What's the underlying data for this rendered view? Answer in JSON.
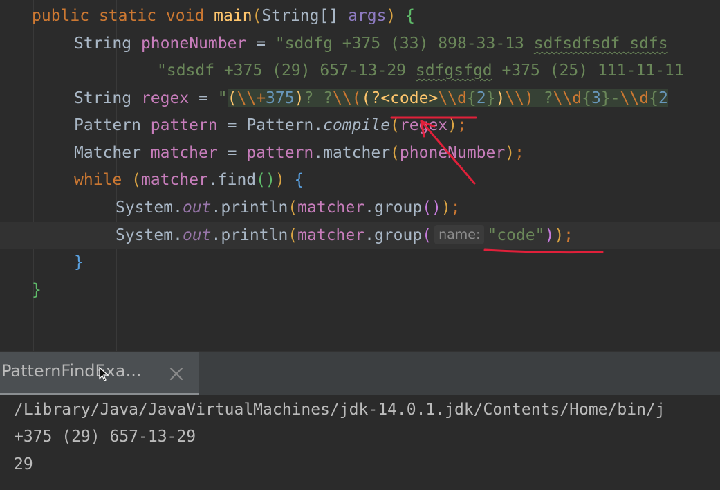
{
  "editor": {
    "lines": [
      {
        "parts": [
          "public",
          "static",
          "void",
          "main",
          "(",
          "String",
          "[]",
          "args",
          ")",
          "{"
        ]
      },
      {
        "var_type": "String",
        "var_name": "phoneNumber",
        "op": "=",
        "str_a": "\"sddfg +375 (33) 898-33-13 ",
        "str_b": "sdfsdfsdf",
        "str_c": " sdfs"
      },
      {
        "str_a": "\"sdsdf +375 (29) 657-13-29 ",
        "str_b": "sdfgsfgd",
        "str_c": " +375 (25) 111-11-11"
      },
      {
        "var_type": "String",
        "var_name": "regex",
        "op": "=",
        "quote": "\"",
        "rx_open": "(",
        "rx_esc1": "\\\\+",
        "rx_num1": "375",
        "rx_close": ")",
        "rx_q1": "? ?",
        "rx_esc2": "\\\\(",
        "rx_grp_open": "(?<code>",
        "rx_esc3": "\\\\d",
        "rx_q2a": "{",
        "rx_num2": "2",
        "rx_q2b": "}",
        "rx_grp_close": ")",
        "rx_esc4": "\\\\)",
        "rx_q3": " ?",
        "rx_esc5": "\\\\d",
        "rx_q4a": "{",
        "rx_num3": "3",
        "rx_q4b": "}",
        "rx_dash": "-",
        "rx_esc6": "\\\\d",
        "rx_q5a": "{",
        "rx_num4": "2"
      },
      {
        "var_type": "Pattern",
        "var_name": "pattern",
        "op": "=",
        "class": "Pattern",
        "dot": ".",
        "method": "compile",
        "paren_open": "(",
        "arg": "regex",
        "paren_close": ")",
        "semi": ";"
      },
      {
        "var_type": "Matcher",
        "var_name": "matcher",
        "op": "=",
        "obj": "pattern",
        "dot": ".",
        "method": "matcher",
        "paren_open": "(",
        "arg": "phoneNumber",
        "paren_close": ")",
        "semi": ";"
      },
      {
        "kw": "while",
        "paren_open": "(",
        "obj": "matcher",
        "dot": ".",
        "method": "find",
        "call": "()",
        "paren_close": ")",
        "brace": "{"
      },
      {
        "cls": "System",
        "dot1": ".",
        "field": "out",
        "dot2": ".",
        "method": "println",
        "p1": "(",
        "obj": "matcher",
        "dot3": ".",
        "m2": "group",
        "call": "()",
        "p2": ")",
        "semi": ";"
      },
      {
        "cls": "System",
        "dot1": ".",
        "field": "out",
        "dot2": ".",
        "method": "println",
        "p1": "(",
        "obj": "matcher",
        "dot3": ".",
        "m2": "group",
        "p_open": "(",
        "hint": "name:",
        "arg": "\"code\"",
        "p_close": ")",
        "p2": ")",
        "semi": ";"
      },
      {
        "brace": "}"
      },
      {
        "brace": "}"
      }
    ]
  },
  "run_panel": {
    "tab_label": "PatternFindExa...",
    "close_icon": "close-icon"
  },
  "console": {
    "lines": [
      "/Library/Java/JavaVirtualMachines/jdk-14.0.1.jdk/Contents/Home/bin/j",
      "+375 (29) 657-13-29",
      "29"
    ]
  },
  "colors": {
    "background": "#2b2b2b",
    "keyword": "#cc7832",
    "string": "#6a8759",
    "method_decl": "#ffc66d",
    "field": "#9876aa",
    "number": "#6897bb",
    "annotation_red": "#e0203a"
  }
}
